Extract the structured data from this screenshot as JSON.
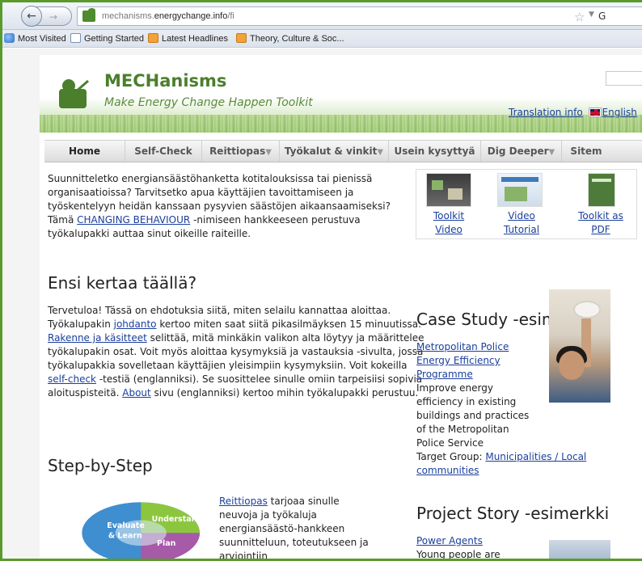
{
  "browser": {
    "url_prefix": "mechanisms.",
    "url_domain": "energychange.info",
    "url_path": "/fi",
    "url_partial_right": "G",
    "bookmarks": [
      "Most Visited",
      "Getting Started",
      "Latest Headlines",
      "Theory, Culture & Soc..."
    ],
    "bookmark_icons": [
      "most-visited-icon",
      "document-icon",
      "rss-icon",
      "rss-icon"
    ]
  },
  "header": {
    "title": "MECHanisms",
    "subtitle": "Make Energy Change Happen Toolkit",
    "translation_label": "Translation info",
    "language_label": "English"
  },
  "menu": {
    "items": [
      {
        "label": "Home"
      },
      {
        "label": "Self-Check"
      },
      {
        "label": "Reittiopas"
      },
      {
        "label": "Työkalut & vinkit"
      },
      {
        "label": "Usein kysyttyä"
      },
      {
        "label": "Dig Deeper"
      },
      {
        "label": "Sitem"
      }
    ],
    "dropdown_glyph": "▼"
  },
  "intro": {
    "text_before": "Suunnitteletko energiansäästöhanketta kotitalouksissa tai pienissä organisaatioissa? Tarvitsetko apua käyttäjien tavoittamiseen ja työskentelyyn heidän kanssaan pysyvien säästöjen aikaansaamiseksi? Tämä ",
    "link": "CHANGING BEHAVIOUR",
    "text_after": " -nimiseen hankkeeseen perustuva työkalupakki auttaa sinut oikeille raiteille."
  },
  "videos": [
    {
      "line1": "Toolkit",
      "line2": "Video"
    },
    {
      "line1": "Video",
      "line2": "Tutorial"
    },
    {
      "line1": "Toolkit as",
      "line2": "PDF"
    }
  ],
  "first_time": {
    "heading": "Ensi kertaa täällä?",
    "t1": "Tervetuloa! Tässä on ehdotuksia siitä, miten selailu kannattaa aloittaa. Työkalupakin ",
    "l1": "johdanto",
    "t2": " kertoo miten saat siitä pikasilmäyksen 15 minuutissa. ",
    "l2": "Rakenne ja käsitteet",
    "t3": " selittää, mitä minkäkin valikon alta löytyy ja määrittelee työkalupakin osat. Voit myös aloittaa kysymyksiä ja vastauksia -sivulta, jossa työkalupakkia sovelletaan käyttäjien yleisimpiin kysymyksiin.  Voit kokeilla ",
    "l3": "self-check",
    "t4": " -testiä (englanniksi). Se suosittelee sinulle omiin tarpeisiisi sopivia aloituspisteitä. ",
    "l4": "About",
    "t5": " sivu (englanniksi) kertoo mihin työkalupakki perustuu."
  },
  "case_study": {
    "heading": "Case Study -esimerkki",
    "link_lines": [
      "Metropolitan Police",
      "Energy Efficiency",
      "Programme"
    ],
    "desc_lines": [
      "Improve energy",
      "efficiency in existing",
      "buildings and practices",
      "of the Metropolitan",
      "Police Service"
    ],
    "target_label": "Target Group: ",
    "target_link_1": "Municipalities / Local",
    "target_link_2": "communities"
  },
  "step_by_step": {
    "heading": "Step-by-Step",
    "link": "Reittiopas",
    "text_lines": [
      " tarjoaa sinulle",
      "neuvoja ja työkaluja",
      "energiansäästö-hankkeen",
      "suunnitteluun, toteutukseen ja",
      "arviointiin"
    ],
    "diagram_labels": [
      "Evaluate",
      "& Learn",
      "Understand",
      "Plan"
    ]
  },
  "project_story": {
    "heading": "Project Story -esimerkki",
    "link": "Power Agents",
    "text": "Young people are"
  },
  "colors": {
    "frame_green": "#5a9a2c",
    "brand_green": "#4b7f2c",
    "link_blue": "#1a3f9c"
  }
}
